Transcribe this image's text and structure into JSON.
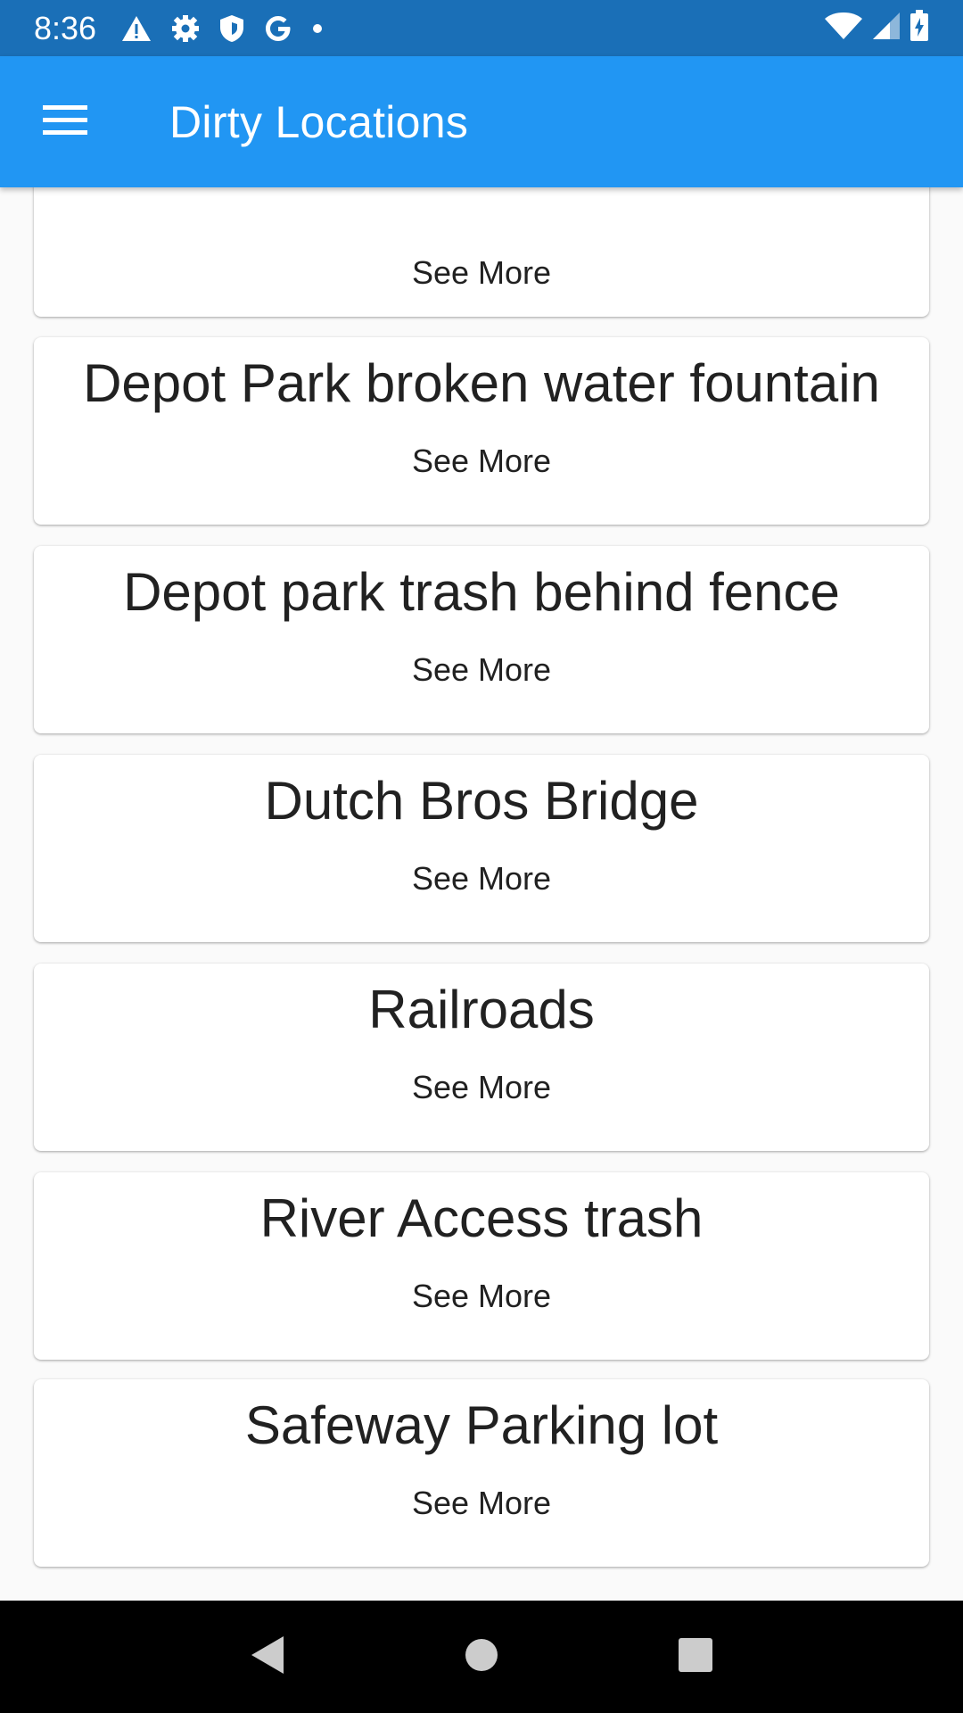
{
  "status_bar": {
    "time": "8:36",
    "icons": [
      "warning-icon",
      "gear-icon",
      "shield-icon",
      "google-icon",
      "dot-icon"
    ],
    "right_icons": [
      "wifi-icon",
      "signal-icon",
      "battery-icon"
    ]
  },
  "app_bar": {
    "title": "Dirty Locations",
    "menu_icon": "menu-icon"
  },
  "locations": [
    {
      "title": "",
      "see_more": "See More"
    },
    {
      "title": "Depot Park broken water fountain",
      "see_more": "See More"
    },
    {
      "title": "Depot park trash behind fence",
      "see_more": "See More"
    },
    {
      "title": "Dutch Bros Bridge",
      "see_more": "See More"
    },
    {
      "title": "Railroads",
      "see_more": "See More"
    },
    {
      "title": "River Access trash",
      "see_more": "See More"
    },
    {
      "title": "Safeway Parking lot",
      "see_more": "See More"
    }
  ],
  "nav_bar": {
    "icons": [
      "back-icon",
      "home-icon",
      "recents-icon"
    ]
  },
  "colors": {
    "status_bar": "#1a6fb7",
    "app_bar": "#2196f3",
    "background": "#fafafa",
    "nav_bar": "#000000"
  }
}
